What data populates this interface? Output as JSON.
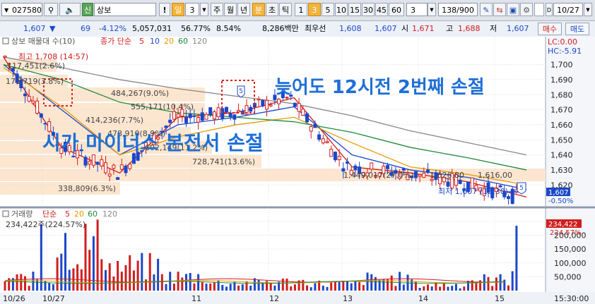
{
  "toolbar": {
    "code": "027580",
    "search_icon": "search-icon",
    "sound_icon": "speaker-icon",
    "market_badge": "신",
    "stock_name": "상보",
    "warn_label": "!",
    "day_label": "일",
    "day_count": "3",
    "week_label": "주",
    "month_label": "월",
    "year_label": "년",
    "minute_label": "분",
    "second_label": "초",
    "tick_label": "틱",
    "intervals": [
      "1",
      "3",
      "5",
      "10",
      "15",
      "30",
      "45",
      "60"
    ],
    "active_interval": "3",
    "stepper_value": "3",
    "page_count": "138/900",
    "date_value": "10/27"
  },
  "info": {
    "price": "1,607",
    "change": "69",
    "change_pct": "-4.12%",
    "volume": "5,057,031",
    "vol_ratio": "56.77%",
    "turnover_pct": "8.54%",
    "amount": "8,286백만",
    "best_ask_label": "최우선",
    "best_ask": "1,608",
    "best_bid": "1,607",
    "open_label": "시",
    "open": "1,671",
    "high_label": "고",
    "high": "1,688",
    "low_label": "저",
    "low": "1,607",
    "buy_label": "매수",
    "sell_label": "매도"
  },
  "price_panel": {
    "profile_label": "상보 매물대 수(10)",
    "ma_label": "종가 단순",
    "ma_periods": [
      "5",
      "10",
      "20",
      "60",
      "120"
    ],
    "high_note": "최고 1,708 (14:57)",
    "low_note": "최저 1,607 (15:30)",
    "lc_label": "LC:0.00",
    "hc_label": "HC:-5.91",
    "last_price_tag": "1,607",
    "last_pct_tag": "-0.50%",
    "marker": "5",
    "profile_labels": [
      "117,451(2.6%)",
      "171,719(3.8%)",
      "484,267(9.0%)",
      "555,171(10.4%)",
      "414,236(7.7%)",
      "478,910(8.9%)",
      "602,149(11.2%)",
      "728,741(13.6%)",
      "1,449,017(27.0%)",
      "1,626,80",
      "1,616,00",
      "338,809(6.3%)"
    ]
  },
  "annotations": {
    "top_note": "늦어도 12시전 2번째 손절",
    "left_note": "시가 마이너스 본전서 손절"
  },
  "volume_panel": {
    "label": "거래량",
    "ma_label": "단순",
    "ma_periods": [
      "5",
      "20",
      "60",
      "120"
    ],
    "last_volume": "234,422주(224.57%)",
    "last_tag": "234,422",
    "last_pct_tag": "224.57%"
  },
  "time_axis": [
    "10/26",
    "10/27",
    "11",
    "12",
    "13",
    "14",
    "15"
  ],
  "time_axis_right": "15:30:00",
  "chart_data": [
    {
      "type": "line",
      "title": "",
      "xlabel": "",
      "ylabel": "",
      "ylim": [
        1607,
        1712
      ],
      "y_ticks": [
        1700,
        1690,
        1680,
        1670,
        1660,
        1650,
        1640,
        1630,
        1620
      ],
      "categories": [
        "10/26",
        "10/27",
        "11",
        "12",
        "13",
        "14",
        "15"
      ],
      "series": [
        {
          "name": "5",
          "values": [
            1705,
            1645,
            1628,
            1665,
            1668,
            1678,
            1632,
            1628,
            1622,
            1612
          ]
        },
        {
          "name": "10",
          "values": [
            1700,
            1670,
            1640,
            1660,
            1665,
            1672,
            1640,
            1630,
            1625,
            1617
          ]
        },
        {
          "name": "20",
          "values": [
            1698,
            1672,
            1640,
            1652,
            1660,
            1665,
            1648,
            1632,
            1627,
            1620
          ]
        },
        {
          "name": "60",
          "values": [
            1700,
            1690,
            1675,
            1668,
            1665,
            1662,
            1655,
            1645,
            1638,
            1630
          ]
        },
        {
          "name": "120",
          "values": [
            1705,
            1698,
            1690,
            1684,
            1679,
            1674,
            1666,
            1656,
            1648,
            1640
          ]
        }
      ],
      "grid": true
    },
    {
      "type": "bar",
      "title": "",
      "xlabel": "",
      "ylabel": "",
      "ylim": [
        0,
        260000
      ],
      "y_ticks": [
        250000,
        200000,
        150000,
        100000,
        50000
      ],
      "categories": [
        "10/26",
        "10/27",
        "11",
        "12",
        "13",
        "14",
        "15"
      ],
      "values": [
        60000,
        240000,
        120000,
        70000,
        40000,
        45000,
        35000,
        60000,
        30000,
        55000,
        234422
      ],
      "grid": true
    }
  ]
}
